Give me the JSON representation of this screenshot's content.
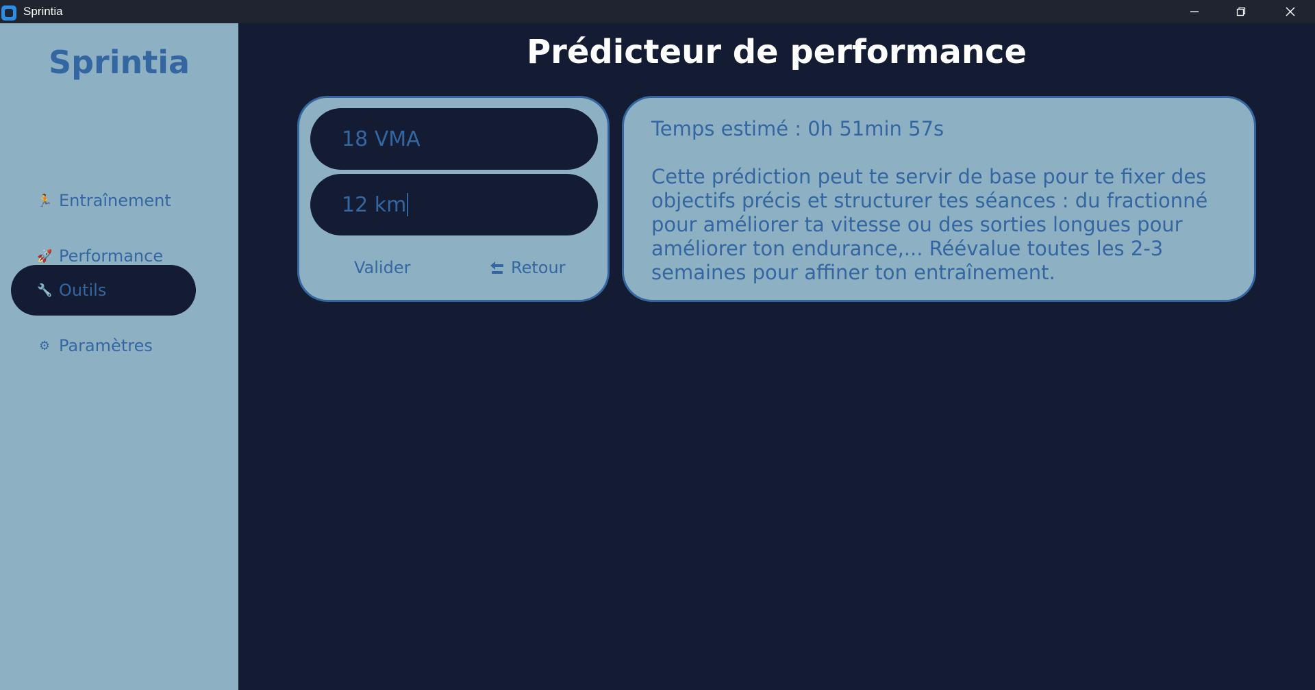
{
  "window": {
    "title": "Sprintia",
    "app_icon": "app-logo-icon",
    "controls": [
      "minimize-icon",
      "restore-icon",
      "close-icon"
    ]
  },
  "sidebar": {
    "brand": "Sprintia",
    "items": [
      {
        "label": "Entraînement",
        "icon": "runner-icon",
        "glyph": "🏃",
        "active": false
      },
      {
        "label": "Performance",
        "icon": "rocket-icon",
        "glyph": "🚀",
        "active": false
      },
      {
        "label": "Outils",
        "icon": "wrench-icon",
        "glyph": "🔧",
        "active": true
      },
      {
        "label": "Paramètres",
        "icon": "gear-icon",
        "glyph": "⚙",
        "active": false
      }
    ]
  },
  "main": {
    "title": "Prédicteur de performance",
    "form": {
      "vma_value": "18 VMA",
      "distance_value": "12 km",
      "validate_label": "Valider",
      "back_label": "Retour",
      "back_icon": "back-arrow-icon"
    },
    "result": {
      "time": "Temps estimé : 0h 51min 57s",
      "advice": "Cette prédiction peut te servir de base pour te fixer des objectifs précis et structurer tes séances : du fractionné pour améliorer ta vitesse ou des sorties longues pour améliorer ton endurance,... Réévalue toutes les 2-3 semaines pour affiner ton entraînement."
    }
  },
  "colors": {
    "background": "#131c33",
    "sidebar": "#8db1c3",
    "accent": "#3466a2",
    "titlebar": "#1f2430"
  }
}
